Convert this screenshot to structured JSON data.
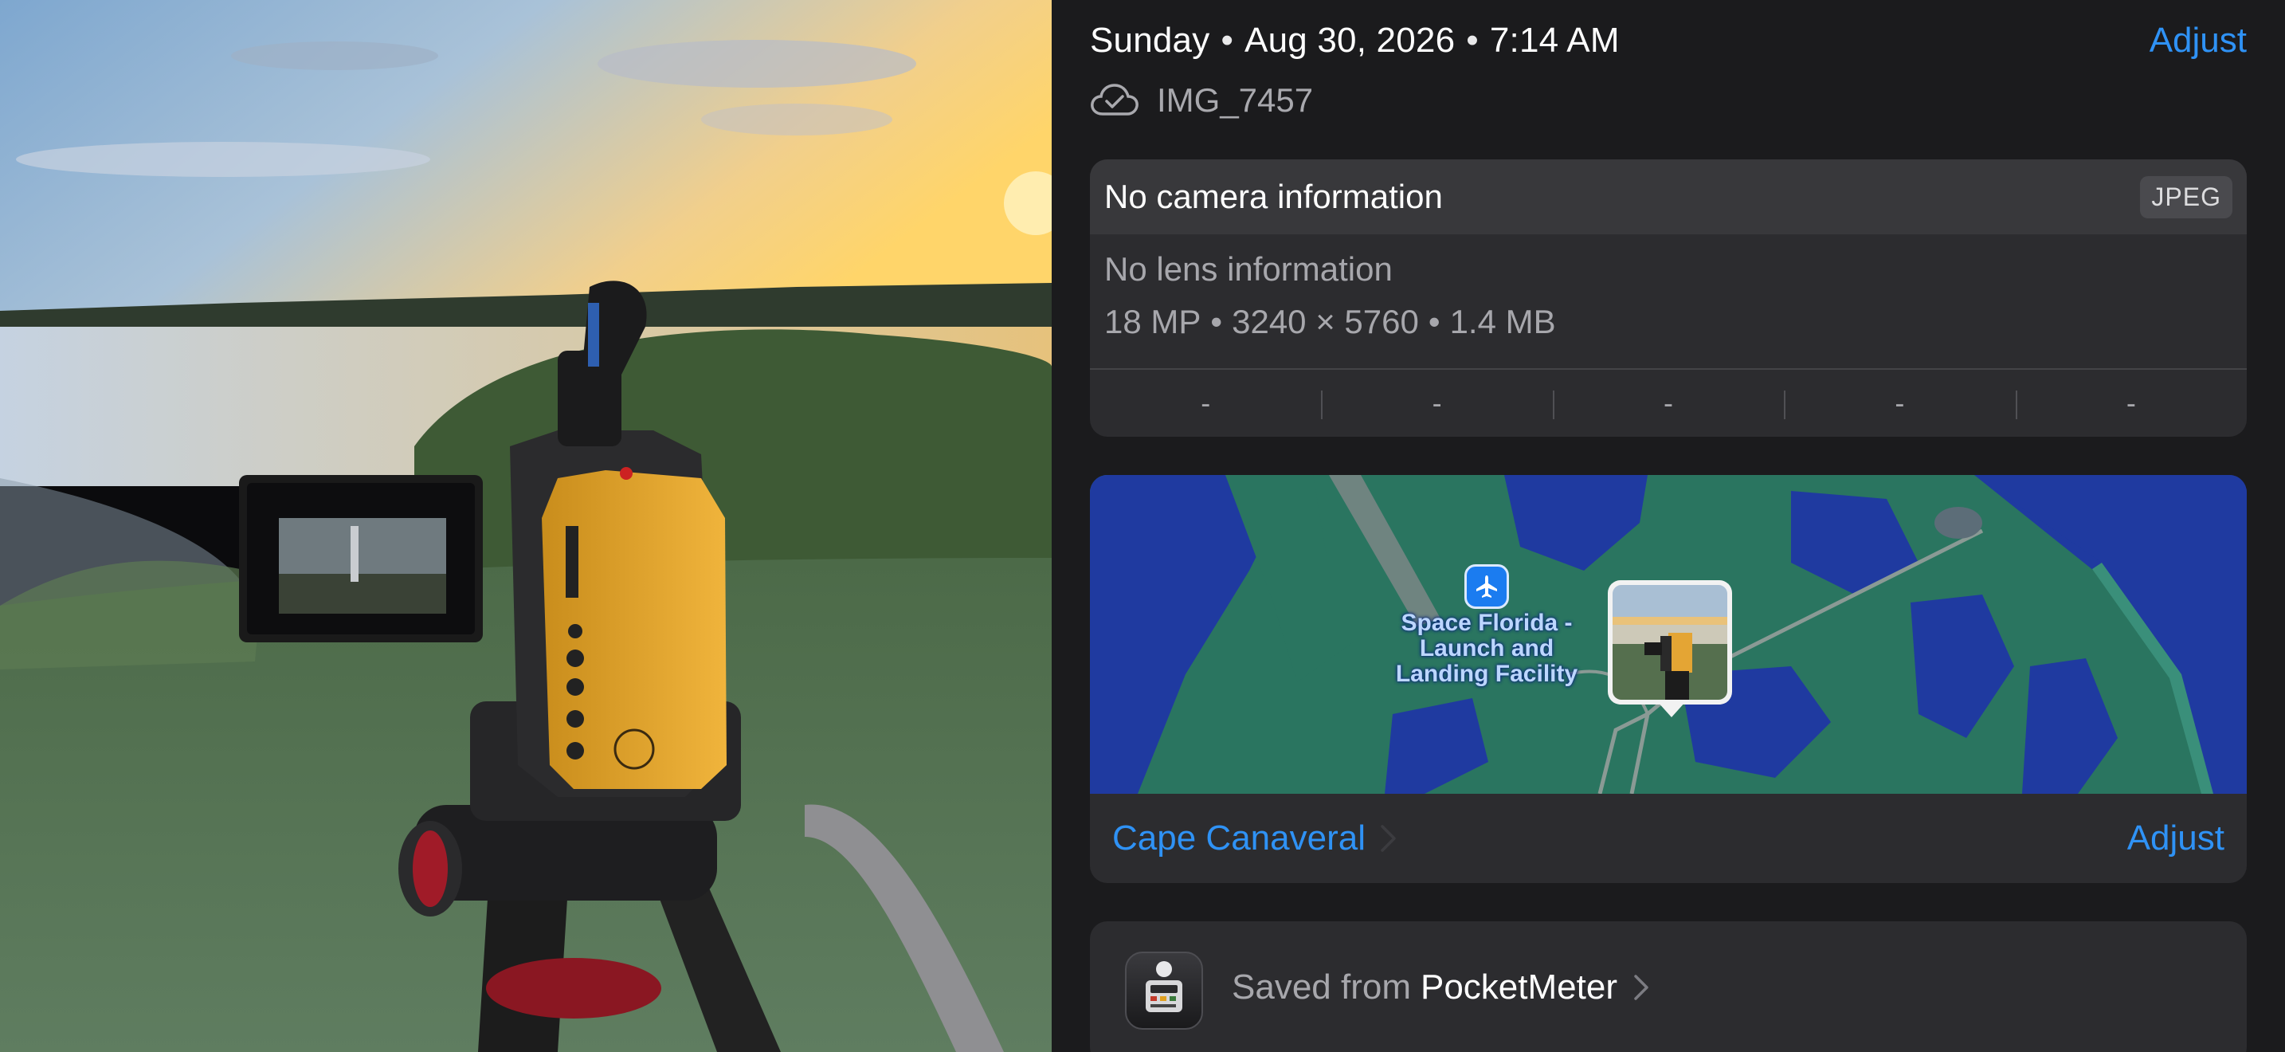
{
  "header": {
    "day": "Sunday",
    "date": "Aug 30, 2026",
    "time": "7:14 AM",
    "separator": "•",
    "adjust_label": "Adjust"
  },
  "file": {
    "icon": "icloud-check-icon",
    "name": "IMG_7457"
  },
  "camera": {
    "title": "No camera information",
    "format_badge": "JPEG",
    "lens": "No lens information",
    "megapixels": "18 MP",
    "dimensions": "3240 × 5760",
    "file_size": "1.4 MB",
    "exif": [
      "-",
      "-",
      "-",
      "-",
      "-"
    ]
  },
  "map": {
    "poi_label_lines": [
      "Space Florida -",
      "Launch and",
      "Landing Facility"
    ],
    "poi_icon": "airplane-icon",
    "location_name": "Cape Canaveral",
    "adjust_label": "Adjust",
    "colors": {
      "water": "#1f3aa0",
      "land": "#2a7560",
      "road": "#8a9a95"
    }
  },
  "saved_from": {
    "prefix": "Saved from",
    "app_name": "PocketMeter",
    "app_icon": "light-meter-app-icon"
  },
  "colors": {
    "accent": "#2f92f5",
    "panel": "#1b1b1d",
    "card": "#2c2c2f"
  }
}
